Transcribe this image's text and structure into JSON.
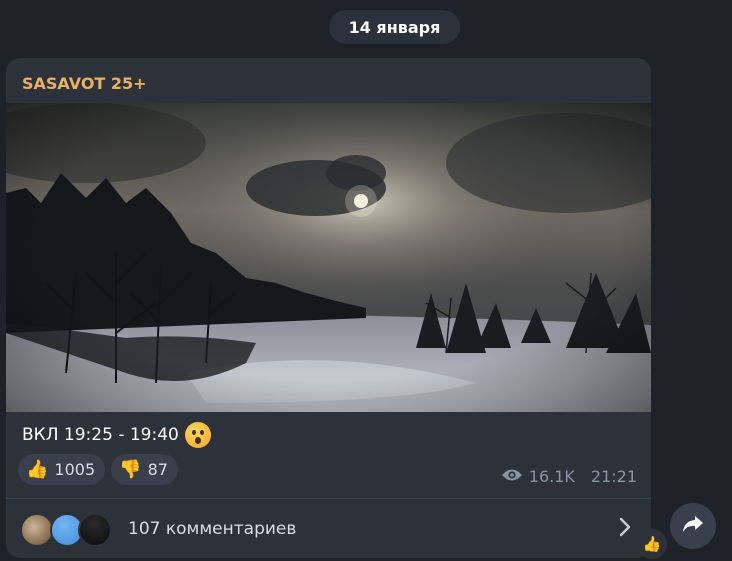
{
  "date_separator": "14 января",
  "post": {
    "channel_name": "SASAVOT 25+",
    "caption": "ВКЛ 19:25 - 19:40",
    "caption_emoji": "hushed-face-emoji",
    "reactions": [
      {
        "emoji": "👍",
        "count": "1005"
      },
      {
        "emoji": "👎",
        "count": "87"
      }
    ],
    "views": "16.1K",
    "time": "21:21",
    "comments_label": "107 комментариев"
  },
  "side_reaction": "👍",
  "icons": {
    "views": "eye-icon",
    "comments_open": "chevron-right-icon",
    "share": "share-arrow-icon"
  },
  "colors": {
    "background": "#1e2128",
    "bubble": "#2c313a",
    "channel_name": "#e8b15e",
    "meta_text": "#8a93a0"
  }
}
